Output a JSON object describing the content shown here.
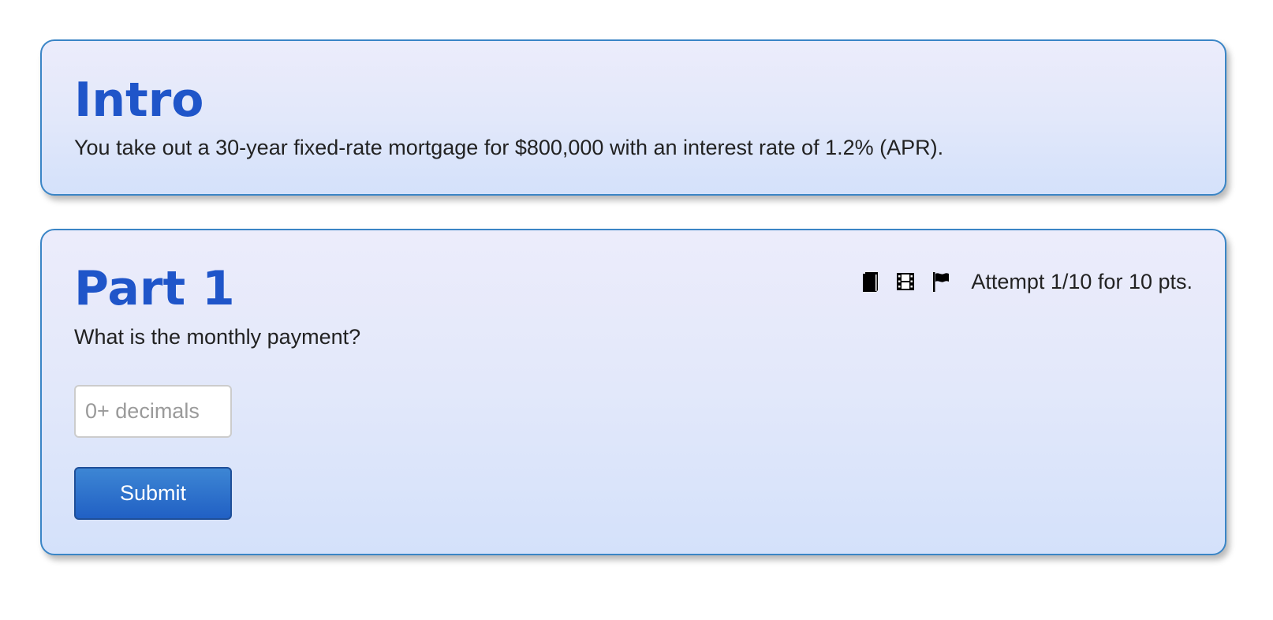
{
  "intro": {
    "title": "Intro",
    "text": "You take out a 30-year fixed-rate mortgage for $800,000 with an interest rate of 1.2% (APR)."
  },
  "part1": {
    "title": "Part 1",
    "question": "What is the monthly payment?",
    "answer": {
      "value": "",
      "placeholder": "0+ decimals"
    },
    "submit_label": "Submit",
    "attempt_text": "Attempt 1/10 for 10 pts.",
    "icons": [
      "book-icon",
      "film-icon",
      "flag-icon"
    ]
  },
  "colors": {
    "heading": "#1f55c9",
    "card_border": "#3a85c6",
    "button": "#2160c4"
  }
}
